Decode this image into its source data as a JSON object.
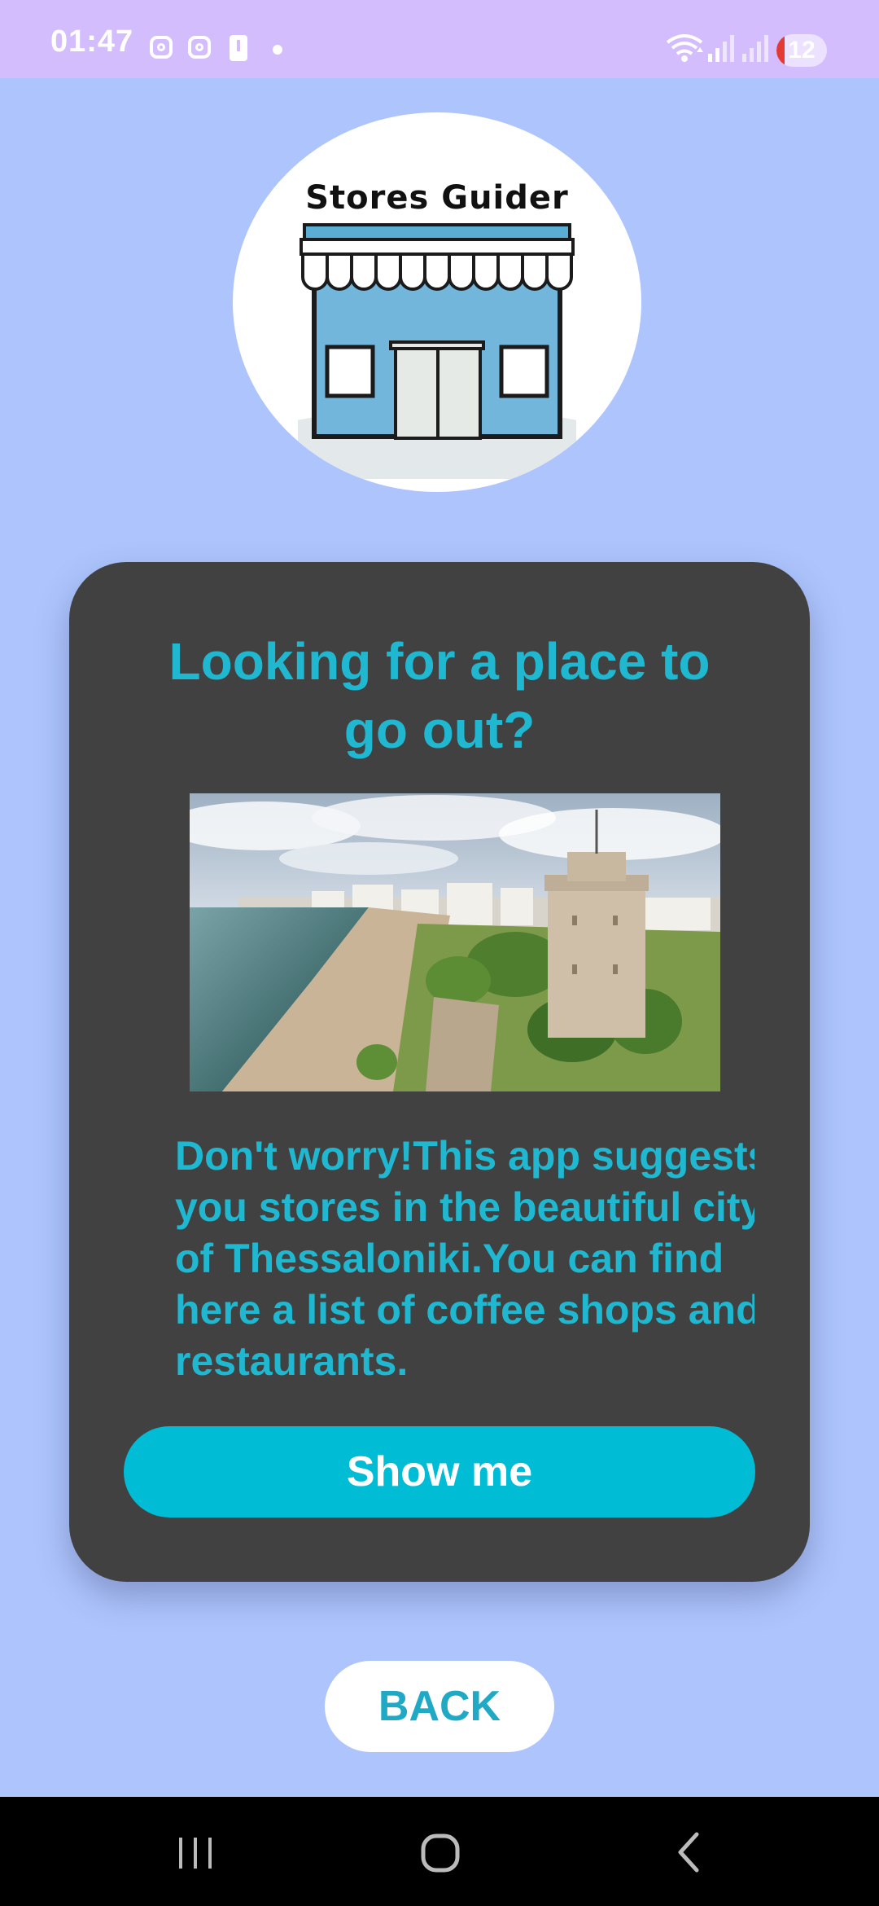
{
  "status_bar": {
    "time": "01:47",
    "battery_level": "12",
    "icons": [
      "instagram-icon",
      "instagram-icon",
      "battery-alert-icon",
      "dot-icon",
      "wifi-icon",
      "signal-icon",
      "signal-icon",
      "battery-icon"
    ]
  },
  "logo": {
    "text": "Stores Guider",
    "icon": "storefront-icon"
  },
  "card": {
    "title_line1": "Looking for a place to",
    "title_line2": "go out?",
    "image_icon": "thessaloniki-white-tower-image",
    "description_lines": [
      "Don't worry!This app suggests",
      "you stores in the beautiful city",
      "of Thessaloniki.You can find",
      "here a list of coffee shops and",
      "restaurants."
    ],
    "show_button_label": "Show me"
  },
  "back_button_label": "BACK",
  "nav_bar": {
    "icons": [
      "recent-apps-icon",
      "home-icon",
      "back-icon"
    ]
  },
  "colors": {
    "background": "#adc4fc",
    "status_bar": "#d4bdfc",
    "card": "#414141",
    "accent": "#00bcd4",
    "title_text": "#1fb8d0"
  }
}
